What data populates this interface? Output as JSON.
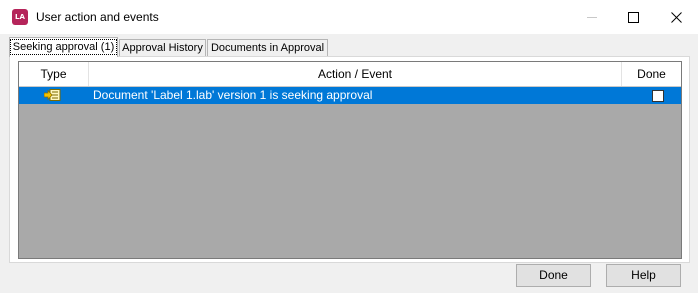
{
  "window": {
    "title": "User action and events",
    "app_icon_text": "LA"
  },
  "tabs": [
    {
      "label": "Seeking approval (1)",
      "active": true
    },
    {
      "label": "Approval History",
      "active": false
    },
    {
      "label": "Documents in Approval",
      "active": false
    }
  ],
  "grid": {
    "columns": [
      "Type",
      "Action / Event",
      "Done"
    ],
    "rows": [
      {
        "type_icon": "document-arrow-icon",
        "action": "Document 'Label 1.lab' version 1 is seeking approval",
        "done": false,
        "selected": true
      }
    ]
  },
  "buttons": {
    "done_label": "Done",
    "help_label": "Help"
  },
  "colors": {
    "selection": "#0078d7",
    "grid_background": "#a9a9a9",
    "app_icon": "#b5245a"
  }
}
